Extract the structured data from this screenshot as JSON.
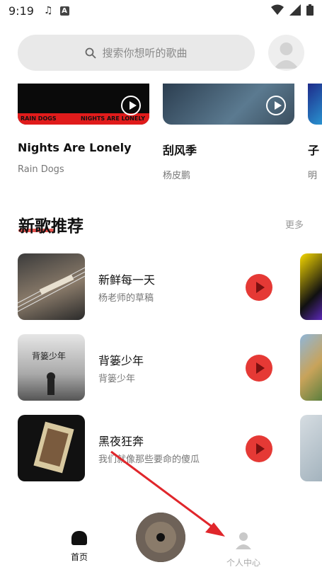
{
  "status_bar": {
    "time": "9:19"
  },
  "search": {
    "placeholder": "搜索你想听的歌曲"
  },
  "top_cards": [
    {
      "title": "Nights Are Lonely",
      "artist": "Rain Dogs",
      "cover_text_left": "RAIN DOGS",
      "cover_text_right": "NIGHTS ARE LONELY"
    },
    {
      "title": "刮风季",
      "artist": "杨皮鹏"
    },
    {
      "title": "子",
      "artist": "明"
    }
  ],
  "section": {
    "title": "新歌推荐",
    "more": "更多"
  },
  "songs": [
    {
      "name": "新鲜每一天",
      "singer": "杨老师的草稿"
    },
    {
      "name": "背篓少年",
      "singer": "背篓少年"
    },
    {
      "name": "黑夜狂奔",
      "singer": "我们就像那些要命的傻瓜"
    }
  ],
  "nav": {
    "home": "首页",
    "profile": "个人中心"
  },
  "colors": {
    "accent": "#e53935",
    "annotation_arrow": "#e0262b"
  }
}
